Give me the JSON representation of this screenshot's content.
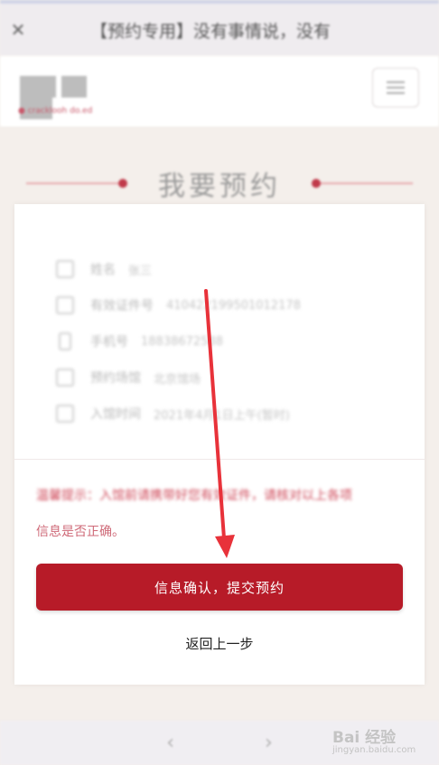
{
  "topbar": {
    "close_glyph": "✕",
    "title": "【预约专用】没有事情说，没有"
  },
  "brand": {
    "sub": "● cracklooh do.ed"
  },
  "heading": {
    "text": "我要预约"
  },
  "info_rows": [
    {
      "label": "姓名",
      "value": "张三",
      "icon": "user-icon"
    },
    {
      "label": "有效证件号",
      "value": "410422199501012178",
      "icon": "id-card-icon"
    },
    {
      "label": "手机号",
      "value": "18838672588",
      "icon": "phone-icon"
    },
    {
      "label": "预约场馆",
      "value": "北京馆场",
      "icon": "building-icon"
    },
    {
      "label": "入馆时间",
      "value": "2021年4月1日上午(暂时)",
      "icon": "calendar-icon"
    }
  ],
  "notice": {
    "blurred": "温馨提示：入馆前请携带好您有效证件，请核对以上各项",
    "tail": "信息是否正确。"
  },
  "actions": {
    "submit_label": "信息确认，提交预约",
    "back_label": "返回上一步"
  },
  "bottom_nav": {
    "back_glyph": "‹",
    "forward_glyph": "›"
  },
  "watermark": {
    "text": "Bai 经验",
    "sub": "jingyan.baidu.com"
  },
  "colors": {
    "primary": "#b71b28",
    "notice": "#cf4a5a",
    "arrow": "#e8323a"
  }
}
